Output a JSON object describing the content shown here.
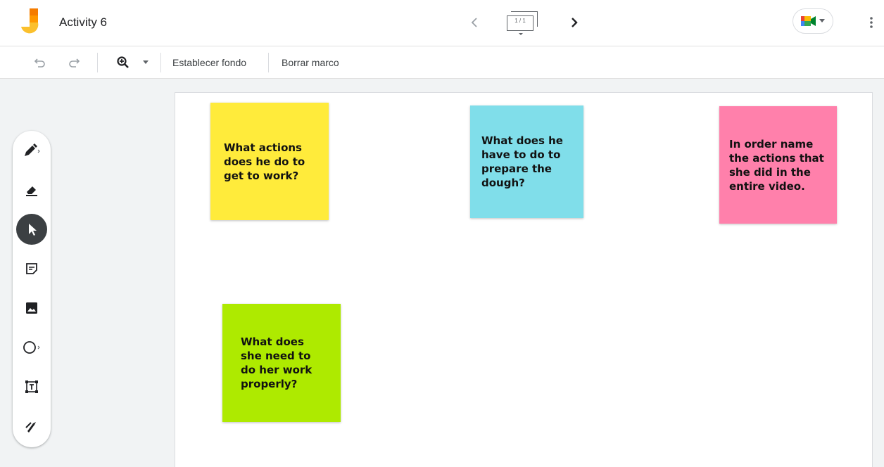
{
  "app": {
    "title": "Activity 6",
    "logo_icon": "jamboard-logo-icon"
  },
  "header": {
    "frame_indicator": "1 / 1",
    "prev_icon": "chevron-left-icon",
    "next_icon": "chevron-right-icon",
    "meet_icon": "google-meet-icon",
    "more_icon": "more-vert-icon"
  },
  "toolbar": {
    "undo_icon": "undo-icon",
    "redo_icon": "redo-icon",
    "zoom_icon": "zoom-in-icon",
    "set_background_label": "Establecer fondo",
    "clear_frame_label": "Borrar marco"
  },
  "tools": [
    {
      "name": "pen",
      "icon": "pen-icon"
    },
    {
      "name": "eraser",
      "icon": "eraser-icon"
    },
    {
      "name": "select",
      "icon": "cursor-icon",
      "active": true
    },
    {
      "name": "sticky-note",
      "icon": "sticky-note-icon"
    },
    {
      "name": "image",
      "icon": "image-icon"
    },
    {
      "name": "circle",
      "icon": "circle-icon"
    },
    {
      "name": "text-box",
      "icon": "text-box-icon"
    },
    {
      "name": "laser",
      "icon": "laser-icon"
    }
  ],
  "notes": [
    {
      "text": "What actions does he do to get to work?",
      "color": "#ffeb3b"
    },
    {
      "text": "What does he have to do to prepare the dough?",
      "color": "#80deea"
    },
    {
      "text": "In order name the actions that she did in the entire video.",
      "color": "#ff80ab"
    },
    {
      "text": "What does she need to do her work properly?",
      "color": "#aeea00"
    }
  ],
  "colors": {
    "accent_active_tool": "#3c4043",
    "note_yellow": "#ffeb3b",
    "note_blue": "#80deea",
    "note_pink": "#ff80ab",
    "note_green": "#aeea00"
  }
}
